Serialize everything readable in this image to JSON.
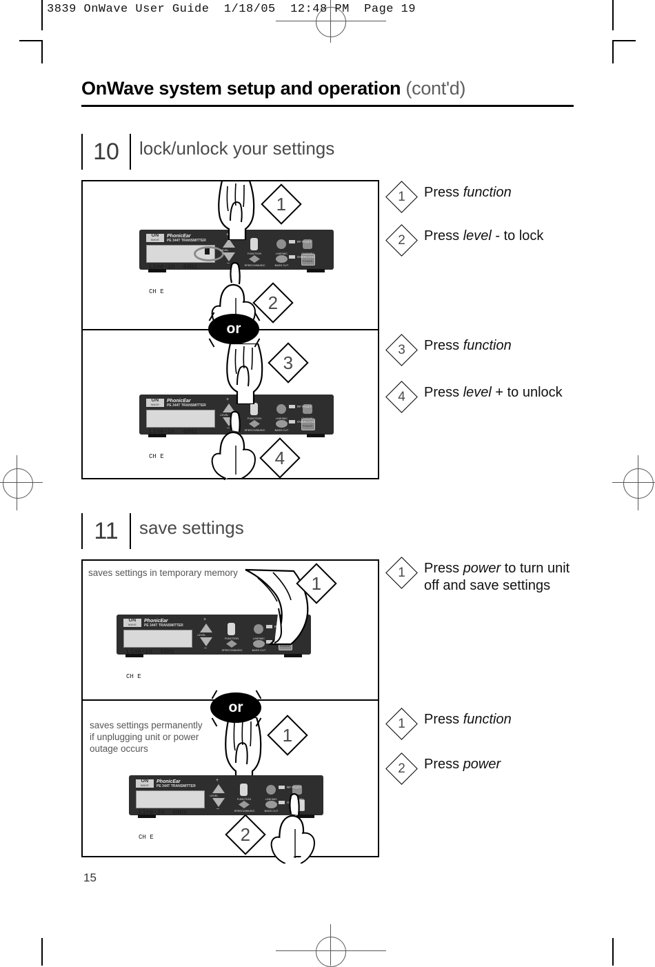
{
  "print_header": "3839 OnWave User Guide  1/18/05  12:48 PM  Page 19",
  "page": {
    "title_main": "OnWave system setup and operation",
    "title_cont": "(cont'd)",
    "page_number": "15"
  },
  "or_badge": "or",
  "device": {
    "logo_on": "ON",
    "logo_wave": "WAVE",
    "brand": "PhonicEar",
    "model": "PE 344T TRANSMITTER",
    "lcd_line1": "Line-in  48Hz",
    "lcd_line2": "CH E",
    "plus": "+",
    "minus": "–",
    "buttons": {
      "level": "LEVEL",
      "function": "FUNCTION",
      "line_mic": "LINE/MIC",
      "channel": "CHANNEL",
      "speech_music": "SPEECH/MUSIC",
      "bass_cut": "BASS CUT",
      "power": "POWER"
    },
    "leds": {
      "rf_fault": "RF FAULT",
      "overload": "OVERLOAD"
    }
  },
  "steps": [
    {
      "number": "10",
      "title": "lock/unlock your settings",
      "panel_markers": [
        "1",
        "2",
        "3",
        "4"
      ],
      "instructions": [
        {
          "num": "1",
          "pre": "Press ",
          "em": "function",
          "post": ""
        },
        {
          "num": "2",
          "pre": "Press ",
          "em": "level",
          "post": " - to lock"
        },
        {
          "num": "3",
          "pre": "Press ",
          "em": "function",
          "post": ""
        },
        {
          "num": "4",
          "pre": "Press ",
          "em": "level",
          "post": " + to unlock"
        }
      ]
    },
    {
      "number": "11",
      "title": "save settings",
      "panel_markers": [
        "1",
        "1",
        "2"
      ],
      "notes": {
        "top": "saves settings in temporary memory",
        "bottom_line1": "saves settings permanently",
        "bottom_line2": "if unplugging unit or power",
        "bottom_line3": "outage occurs"
      },
      "instructions": [
        {
          "num": "1",
          "pre": "Press ",
          "em": "power",
          "post": " to turn unit",
          "line2": "off and save settings"
        },
        {
          "num": "1",
          "pre": "Press ",
          "em": "function",
          "post": ""
        },
        {
          "num": "2",
          "pre": "Press ",
          "em": "power",
          "post": ""
        }
      ]
    }
  ]
}
